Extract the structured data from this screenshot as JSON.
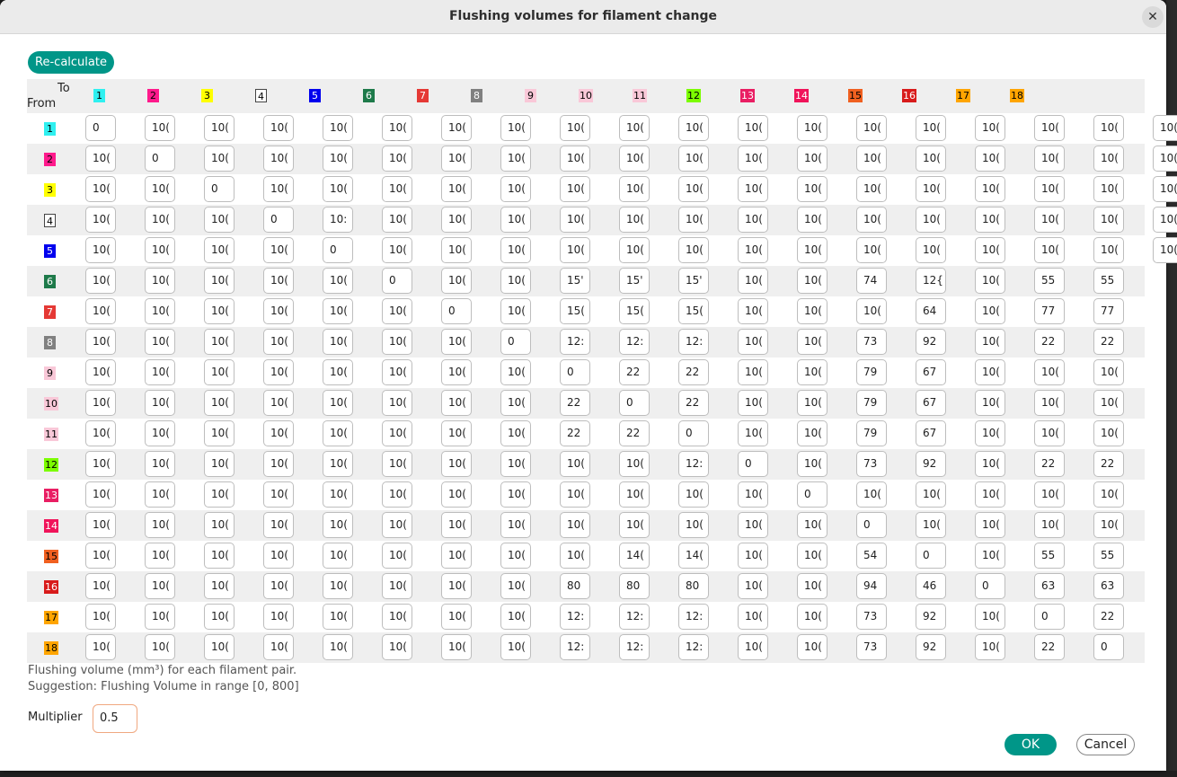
{
  "window": {
    "title": "Flushing volumes for filament change"
  },
  "buttons": {
    "recalculate": "Re-calculate",
    "ok": "OK",
    "cancel": "Cancel",
    "close_glyph": "✕"
  },
  "table": {
    "to_label": "To",
    "from_label": "From",
    "filaments": [
      {
        "label": "1",
        "color": "#2ff0f0",
        "text": "#000000"
      },
      {
        "label": "2",
        "color": "#ff1a8c",
        "text": "#000000"
      },
      {
        "label": "3",
        "color": "#ffff00",
        "text": "#000000"
      },
      {
        "label": "4",
        "color": "#ffffff",
        "text": "#000000"
      },
      {
        "label": "5",
        "color": "#0000ee",
        "text": "#ffffff"
      },
      {
        "label": "6",
        "color": "#1e7a4a",
        "text": "#ffffff"
      },
      {
        "label": "7",
        "color": "#e53935",
        "text": "#ffffff"
      },
      {
        "label": "8",
        "color": "#808080",
        "text": "#ffffff"
      },
      {
        "label": "9",
        "color": "#f9c8d8",
        "text": "#000000"
      },
      {
        "label": "10",
        "color": "#f9c8d8",
        "text": "#000000"
      },
      {
        "label": "11",
        "color": "#f9c8d8",
        "text": "#000000"
      },
      {
        "label": "12",
        "color": "#7cfc00",
        "text": "#000000"
      },
      {
        "label": "13",
        "color": "#e91e63",
        "text": "#ffffff"
      },
      {
        "label": "14",
        "color": "#f0145a",
        "text": "#ffffff"
      },
      {
        "label": "15",
        "color": "#f06020",
        "text": "#000000"
      },
      {
        "label": "16",
        "color": "#d81b1b",
        "text": "#ffffff"
      },
      {
        "label": "17",
        "color": "#ffa500",
        "text": "#000000"
      },
      {
        "label": "18",
        "color": "#ffa500",
        "text": "#000000"
      }
    ],
    "matrix": [
      [
        "0",
        "10(",
        "10(",
        "10(",
        "10(",
        "10(",
        "10(",
        "10(",
        "10(",
        "10(",
        "10(",
        "10(",
        "10(",
        "10(",
        "10(",
        "10(",
        "10(",
        "10(",
        "10("
      ],
      [
        "10(",
        "0",
        "10(",
        "10(",
        "10(",
        "10(",
        "10(",
        "10(",
        "10(",
        "10(",
        "10(",
        "10(",
        "10(",
        "10(",
        "10(",
        "10(",
        "10(",
        "10(",
        "10("
      ],
      [
        "10(",
        "10(",
        "0",
        "10(",
        "10(",
        "10(",
        "10(",
        "10(",
        "10(",
        "10(",
        "10(",
        "10(",
        "10(",
        "10(",
        "10(",
        "10(",
        "10(",
        "10(",
        "10("
      ],
      [
        "10(",
        "10(",
        "10(",
        "0",
        "10:",
        "10(",
        "10(",
        "10(",
        "10(",
        "10(",
        "10(",
        "10(",
        "10(",
        "10(",
        "10(",
        "10(",
        "10(",
        "10(",
        "10("
      ],
      [
        "10(",
        "10(",
        "10(",
        "10(",
        "0",
        "10(",
        "10(",
        "10(",
        "10(",
        "10(",
        "10(",
        "10(",
        "10(",
        "10(",
        "10(",
        "10(",
        "10(",
        "10(",
        "10("
      ],
      [
        "10(",
        "10(",
        "10(",
        "10(",
        "10(",
        "0",
        "10(",
        "10(",
        "15'",
        "15'",
        "15'",
        "10(",
        "10(",
        "74",
        "12{",
        "10(",
        "55",
        "55"
      ],
      [
        "10(",
        "10(",
        "10(",
        "10(",
        "10(",
        "10(",
        "0",
        "10(",
        "15(",
        "15(",
        "15(",
        "10(",
        "10(",
        "10(",
        "64",
        "10(",
        "77",
        "77"
      ],
      [
        "10(",
        "10(",
        "10(",
        "10(",
        "10(",
        "10(",
        "10(",
        "0",
        "12:",
        "12:",
        "12:",
        "10(",
        "10(",
        "73",
        "92",
        "10(",
        "22",
        "22"
      ],
      [
        "10(",
        "10(",
        "10(",
        "10(",
        "10(",
        "10(",
        "10(",
        "10(",
        "0",
        "22",
        "22",
        "10(",
        "10(",
        "79",
        "67",
        "10(",
        "10(",
        "10("
      ],
      [
        "10(",
        "10(",
        "10(",
        "10(",
        "10(",
        "10(",
        "10(",
        "10(",
        "22",
        "0",
        "22",
        "10(",
        "10(",
        "79",
        "67",
        "10(",
        "10(",
        "10("
      ],
      [
        "10(",
        "10(",
        "10(",
        "10(",
        "10(",
        "10(",
        "10(",
        "10(",
        "22",
        "22",
        "0",
        "10(",
        "10(",
        "79",
        "67",
        "10(",
        "10(",
        "10("
      ],
      [
        "10(",
        "10(",
        "10(",
        "10(",
        "10(",
        "10(",
        "10(",
        "10(",
        "10(",
        "10(",
        "12:",
        "0",
        "10(",
        "73",
        "92",
        "10(",
        "22",
        "22"
      ],
      [
        "10(",
        "10(",
        "10(",
        "10(",
        "10(",
        "10(",
        "10(",
        "10(",
        "10(",
        "10(",
        "10(",
        "10(",
        "0",
        "10(",
        "10(",
        "10(",
        "10(",
        "10("
      ],
      [
        "10(",
        "10(",
        "10(",
        "10(",
        "10(",
        "10(",
        "10(",
        "10(",
        "10(",
        "10(",
        "10(",
        "10(",
        "10(",
        "0",
        "10(",
        "10(",
        "10(",
        "10("
      ],
      [
        "10(",
        "10(",
        "10(",
        "10(",
        "10(",
        "10(",
        "10(",
        "10(",
        "10(",
        "14(",
        "14(",
        "10(",
        "10(",
        "54",
        "0",
        "10(",
        "55",
        "55"
      ],
      [
        "10(",
        "10(",
        "10(",
        "10(",
        "10(",
        "10(",
        "10(",
        "10(",
        "80",
        "80",
        "80",
        "10(",
        "10(",
        "94",
        "46",
        "0",
        "63",
        "63"
      ],
      [
        "10(",
        "10(",
        "10(",
        "10(",
        "10(",
        "10(",
        "10(",
        "10(",
        "12:",
        "12:",
        "12:",
        "10(",
        "10(",
        "73",
        "92",
        "10(",
        "0",
        "22"
      ],
      [
        "10(",
        "10(",
        "10(",
        "10(",
        "10(",
        "10(",
        "10(",
        "10(",
        "12:",
        "12:",
        "12:",
        "10(",
        "10(",
        "73",
        "92",
        "10(",
        "22",
        "0"
      ]
    ]
  },
  "info": {
    "line1": "Flushing volume (mm³) for each filament pair.",
    "line2": "Suggestion: Flushing Volume in range [0, 800]"
  },
  "multiplier": {
    "label": "Multiplier",
    "value": "0.5"
  },
  "colors": {
    "accent": "#009688",
    "input_focus": "#f0a880"
  }
}
